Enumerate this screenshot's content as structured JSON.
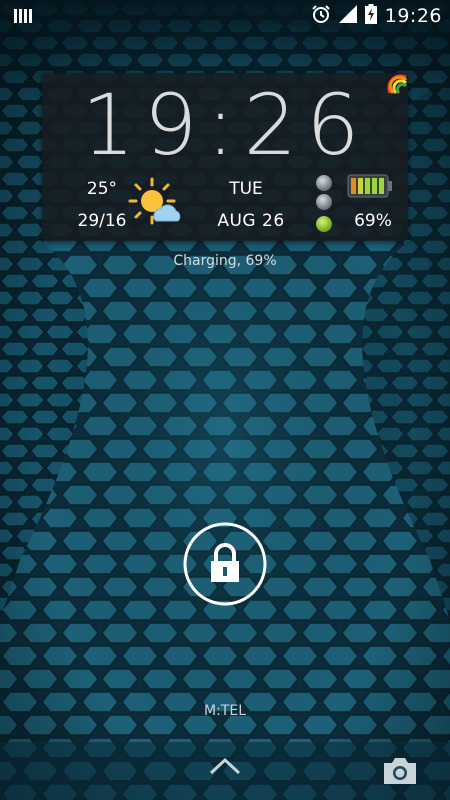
{
  "status_bar": {
    "time": "19:26",
    "icons": [
      "notification-bars-icon",
      "alarm-icon",
      "signal-icon",
      "battery-charging-icon"
    ]
  },
  "widget": {
    "clock": "19:26",
    "temperature": "25°",
    "high_low": "29/16",
    "weather_icon": "sun-cloud-icon",
    "day": "TUE",
    "date": "AUG  26",
    "battery_percent": "69%",
    "battery_level": 0.69
  },
  "lockscreen": {
    "charging_text": "Charging, 69%",
    "carrier": "M:TEL"
  },
  "colors": {
    "background": "#0e3a4c",
    "hex_fill": "#1f6780",
    "widget_bg": "#171d21",
    "battery_green": "#9bd63b",
    "battery_orange": "#e58a1f"
  }
}
